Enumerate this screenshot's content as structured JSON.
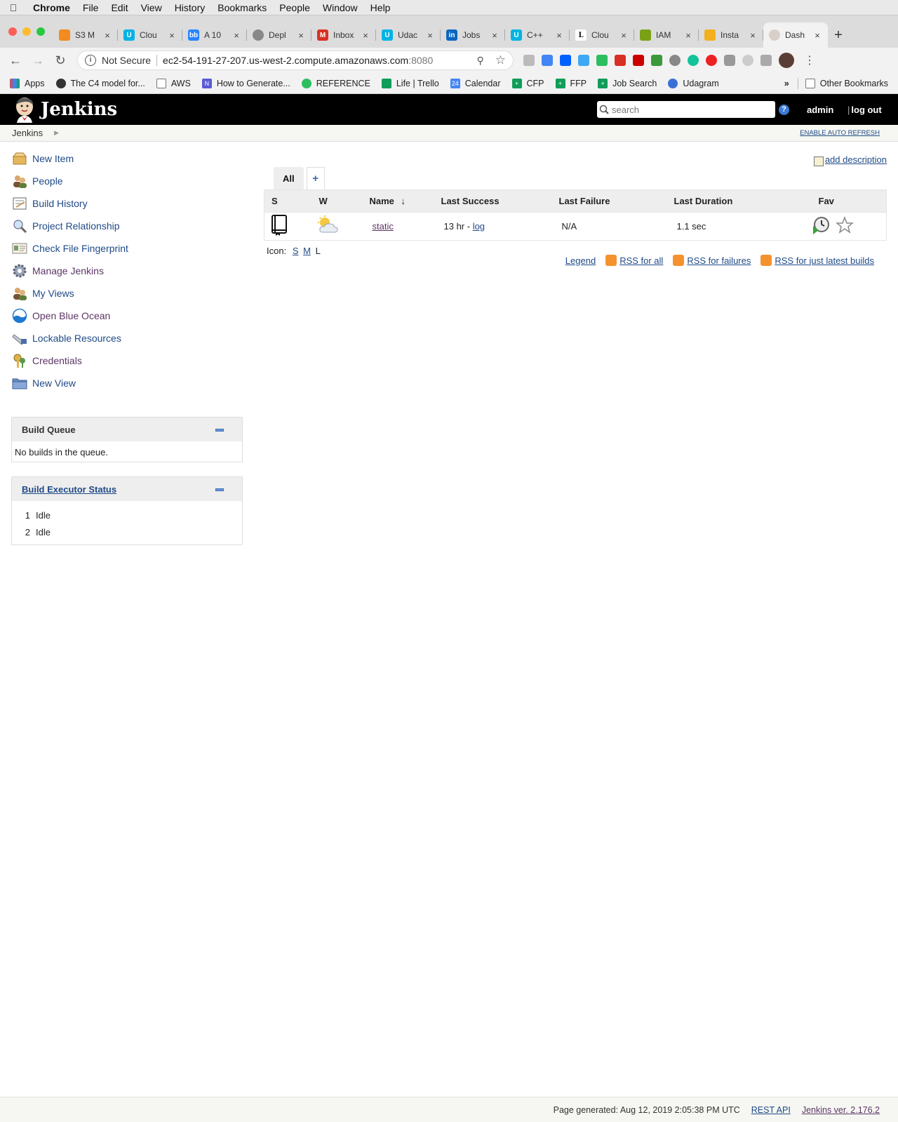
{
  "mac_menu": {
    "items": [
      "Chrome",
      "File",
      "Edit",
      "View",
      "History",
      "Bookmarks",
      "People",
      "Window",
      "Help"
    ]
  },
  "browser": {
    "tabs": [
      {
        "label": "S3 M",
        "icon": "aws-s3-icon",
        "color": "#f28b20"
      },
      {
        "label": "Clou",
        "icon": "udacity-icon",
        "color": "#02b3e4"
      },
      {
        "label": "A 10",
        "icon": "bitbucket-icon",
        "color": "#2684ff"
      },
      {
        "label": "Depl",
        "icon": "globe-icon",
        "color": "#888888"
      },
      {
        "label": "Inbox",
        "icon": "gmail-icon",
        "color": "#d93025"
      },
      {
        "label": "Udac",
        "icon": "udacity-icon",
        "color": "#02b3e4"
      },
      {
        "label": "Jobs",
        "icon": "linkedin-icon",
        "color": "#0a66c2"
      },
      {
        "label": "C++",
        "icon": "udacity-icon",
        "color": "#02b3e4"
      },
      {
        "label": "Clou",
        "icon": "l-icon",
        "color": "#111111"
      },
      {
        "label": "IAM",
        "icon": "iam-icon",
        "color": "#7aa116"
      },
      {
        "label": "Insta",
        "icon": "aws-box-icon",
        "color": "#f2b01e"
      },
      {
        "label": "Dash",
        "icon": "jenkins-icon",
        "color": "#d8d0c8"
      }
    ],
    "security_label": "Not Secure",
    "url_host": "ec2-54-191-27-207.us-west-2.compute.amazonaws.com",
    "url_port": ":8080",
    "bookmarks": [
      {
        "label": "Apps",
        "icon": "apps-grid-icon",
        "color": "#d24b4b"
      },
      {
        "label": "The C4 model for...",
        "icon": "c4-icon",
        "color": "#333333"
      },
      {
        "label": "AWS",
        "icon": "folder-icon",
        "color": "#777777"
      },
      {
        "label": "How to Generate...",
        "icon": "n-logo-icon",
        "color": "#5a5ad6"
      },
      {
        "label": "REFERENCE",
        "icon": "evernote-icon",
        "color": "#2dbe60"
      },
      {
        "label": "Life | Trello",
        "icon": "trello-icon",
        "color": "#0f9d58"
      },
      {
        "label": "Calendar",
        "icon": "calendar-icon",
        "color": "#4285f4"
      },
      {
        "label": "CFP",
        "icon": "sheets-icon",
        "color": "#0f9d58"
      },
      {
        "label": "FFP",
        "icon": "sheets-icon",
        "color": "#0f9d58"
      },
      {
        "label": "Job Search",
        "icon": "sheets-icon",
        "color": "#0f9d58"
      },
      {
        "label": "Udagram",
        "icon": "udagram-icon",
        "color": "#3b6fd6"
      }
    ],
    "more_label": "»",
    "other_bookmarks": "Other Bookmarks"
  },
  "jenkins": {
    "title": "Jenkins",
    "search_placeholder": "search",
    "user": "admin",
    "logout": "log out",
    "breadcrumb": "Jenkins",
    "auto_refresh": "ENABLE AUTO REFRESH",
    "tasks": [
      {
        "label": "New Item",
        "icon": "new-item-icon"
      },
      {
        "label": "People",
        "icon": "people-icon"
      },
      {
        "label": "Build History",
        "icon": "build-history-icon"
      },
      {
        "label": "Project Relationship",
        "icon": "magnifier-icon"
      },
      {
        "label": "Check File Fingerprint",
        "icon": "fingerprint-icon"
      },
      {
        "label": "Manage Jenkins",
        "icon": "gear-icon"
      },
      {
        "label": "My Views",
        "icon": "my-views-icon"
      },
      {
        "label": "Open Blue Ocean",
        "icon": "blue-ocean-icon"
      },
      {
        "label": "Lockable Resources",
        "icon": "lock-resource-icon"
      },
      {
        "label": "Credentials",
        "icon": "credentials-icon"
      },
      {
        "label": "New View",
        "icon": "folder-icon"
      }
    ],
    "build_queue": {
      "title": "Build Queue",
      "empty": "No builds in the queue."
    },
    "executors": {
      "title": "Build Executor Status",
      "rows": [
        {
          "num": "1",
          "status": "Idle"
        },
        {
          "num": "2",
          "status": "Idle"
        }
      ]
    },
    "add_description": "add description",
    "view_tabs": {
      "active": "All",
      "add": "+"
    },
    "table": {
      "headers": {
        "s": "S",
        "w": "W",
        "name": "Name",
        "sort": "↓",
        "last_success": "Last Success",
        "last_failure": "Last Failure",
        "last_duration": "Last Duration",
        "fav": "Fav"
      },
      "rows": [
        {
          "name": "static",
          "last_success": "13 hr - ",
          "log": "log",
          "last_failure": "N/A",
          "last_duration": "1.1 sec",
          "status_icon": "notebook-status-icon",
          "weather_icon": "partly-cloudy-icon"
        }
      ]
    },
    "icon_size": {
      "label": "Icon:",
      "s": "S",
      "m": "M",
      "l": "L"
    },
    "links": {
      "legend": "Legend",
      "rss_all": "RSS for all",
      "rss_failures": "RSS for failures",
      "rss_latest": "RSS for just latest builds"
    },
    "footer": {
      "generated": "Page generated: Aug 12, 2019 2:05:38 PM UTC",
      "rest_api": "REST API",
      "version": "Jenkins ver. 2.176.2"
    }
  }
}
